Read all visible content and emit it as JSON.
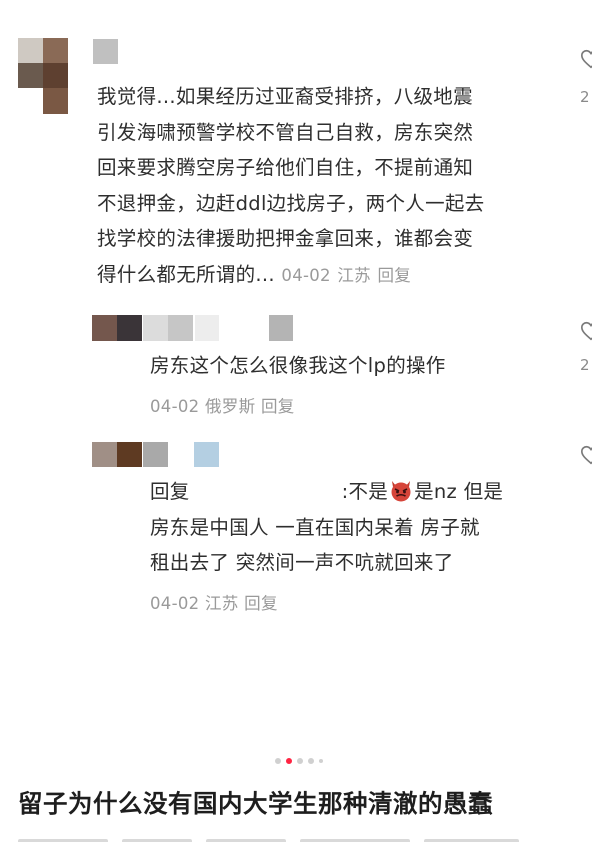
{
  "comments": [
    {
      "text_lines": [
        "我觉得...如果经历过亚裔受排挤，八级地震",
        "引发海啸预警学校不管自己自救，房东突然",
        "回来要求腾空房子给他们自住，不提前通知",
        "不退押金，边赶ddl边找房子，两个人一起去",
        "找学校的法律援助把押金拿回来，谁都会变",
        "得什么都无所谓的..."
      ],
      "date": "04-02",
      "location": "江苏",
      "reply_label": "回复",
      "like_count": "2"
    },
    {
      "text_lines": [
        "房东这个怎么很像我这个lp的操作"
      ],
      "date": "04-02",
      "location": "俄罗斯",
      "reply_label": "回复",
      "like_count": "2"
    },
    {
      "text_prefix": "回复",
      "text_mid_a": ":不是",
      "emoji_name": "devil-emoji",
      "text_mid_b": "是nz 但是",
      "text_lines": [
        "房东是中国人 一直在国内呆着 房子就",
        "租出去了 突然间一声不吭就回来了"
      ],
      "date": "04-02",
      "location": "江苏",
      "reply_label": "回复"
    }
  ],
  "carousel": {
    "total": 5,
    "active": 1
  },
  "post_title": "留子为什么没有国内大学生那种清澈的愚蠢",
  "colors": {
    "accent": "#ff2442",
    "meta": "#9a9a9a"
  }
}
